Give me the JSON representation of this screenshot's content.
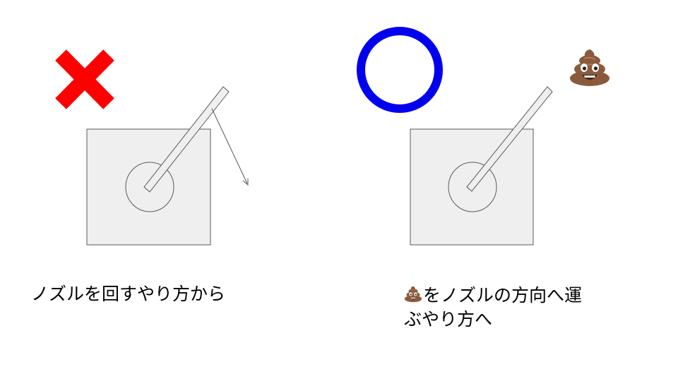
{
  "slide": {
    "left_panel": {
      "verdict": "incorrect",
      "verdict_icon": "red-x-icon",
      "caption": "ノズルを回すやり方から"
    },
    "right_panel": {
      "verdict": "correct",
      "verdict_icon": "blue-circle-icon",
      "target_icon": "poo-icon",
      "caption_line_1": "をノズルの方向へ運",
      "caption_line_2": "ぶやり方へ"
    }
  },
  "colors": {
    "cross_red": "#ff0000",
    "circle_blue": "#0000ee",
    "box_fill": "#efefef",
    "box_stroke": "#595959",
    "poo_brown": "#8b5a3c",
    "text": "#000000"
  }
}
